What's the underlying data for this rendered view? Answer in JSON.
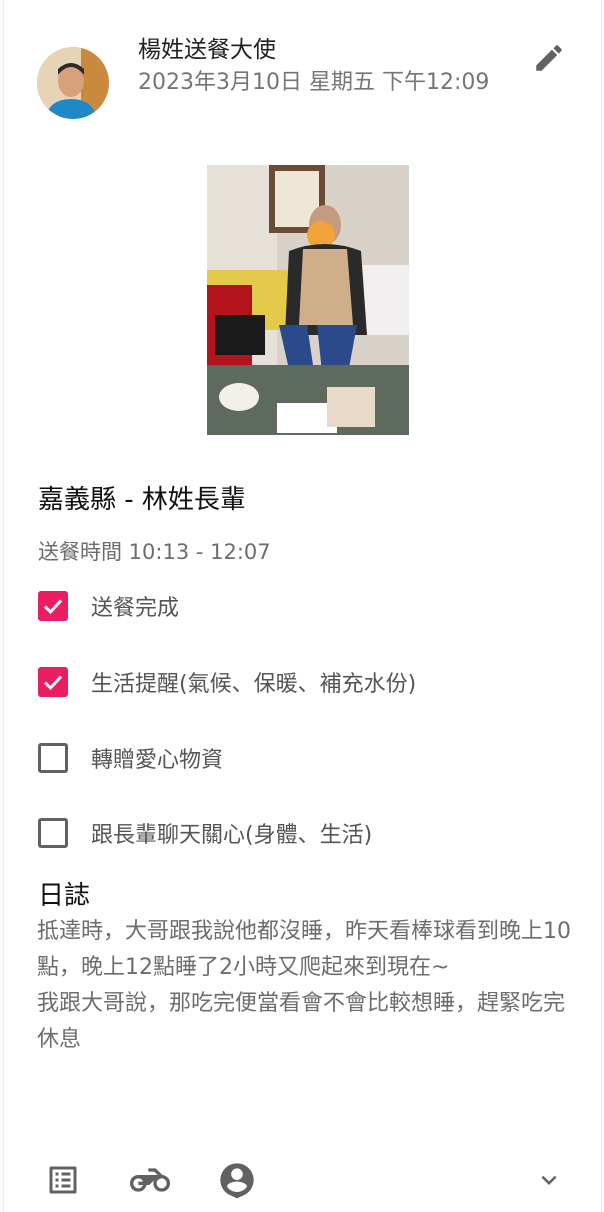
{
  "post": {
    "author": "楊姓送餐大使",
    "timestamp": "2023年3月10日 星期五 下午12:09"
  },
  "icons": {
    "edit": "pencil-icon",
    "list": "list-icon",
    "delivery": "motorcycle-icon",
    "profile": "account-pin-icon",
    "expand": "chevron-down-icon"
  },
  "recipient": "嘉義縣 - 林姓長輩",
  "delivery_time": "送餐時間 10:13 - 12:07",
  "tasks": [
    {
      "label": "送餐完成",
      "checked": true
    },
    {
      "label": "生活提醒(氣候、保暖、補充水份)",
      "checked": true
    },
    {
      "label": "轉贈愛心物資",
      "checked": false
    },
    {
      "label": "跟長輩聊天關心(身體、生活)",
      "checked": false
    }
  ],
  "log": {
    "title": "日誌",
    "body": "抵達時，大哥跟我說他都沒睡，昨天看棒球看到晚上10點，晚上12點睡了2小時又爬起來到現在~\n我跟大哥說，那吃完便當看會不會比較想睡，趕緊吃完休息"
  },
  "colors": {
    "accent": "#e91e63",
    "icon": "#616161"
  }
}
